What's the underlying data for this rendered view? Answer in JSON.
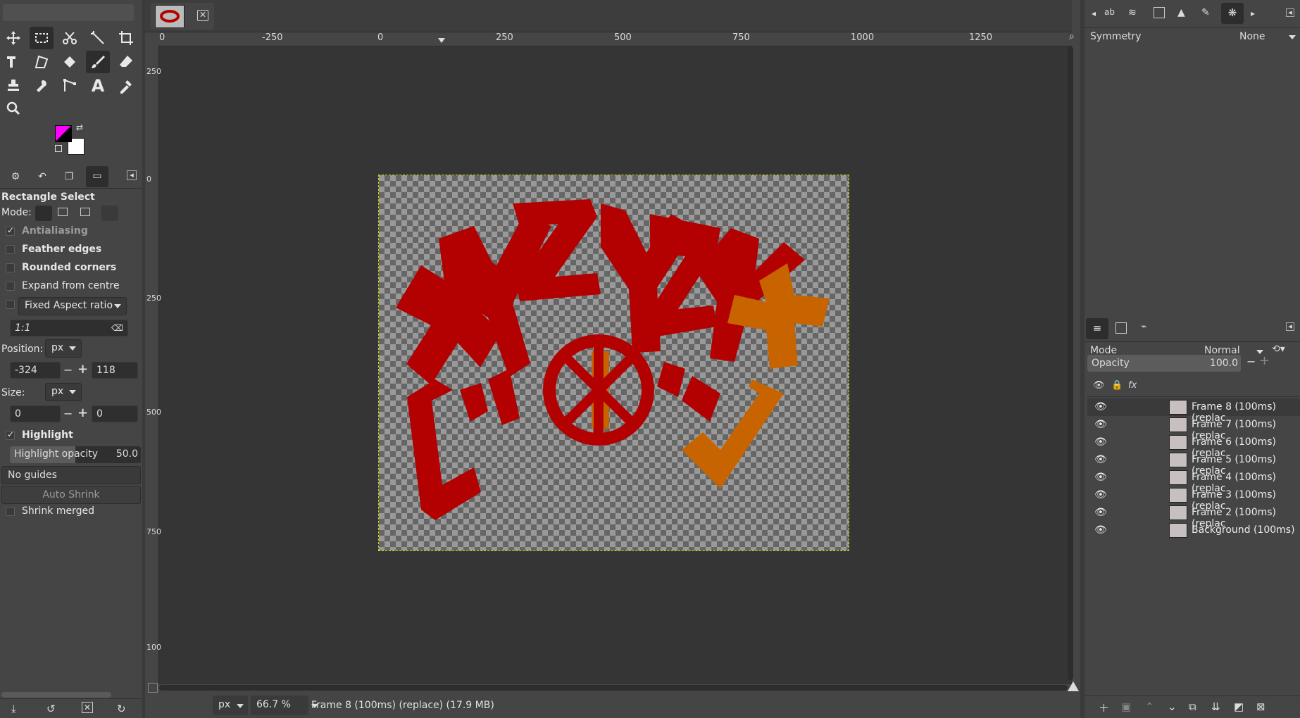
{
  "tab": {
    "close_icon": "close-icon"
  },
  "toolbox": {
    "tools": [
      "move-tool-icon",
      "rectangle-select-icon",
      "scissors-select-icon",
      "fuzzy-select-icon",
      "crop-icon",
      "unified-transform-icon",
      "warp-transform-icon",
      "bucket-fill-icon",
      "paintbrush-icon",
      "eraser-icon",
      "clone-icon",
      "smudge-icon",
      "paths-icon",
      "text-icon",
      "color-picker-icon",
      "zoom-icon"
    ]
  },
  "tool_options": {
    "title": "Rectangle Select",
    "mode_label": "Mode:",
    "antialiasing": "Antialiasing",
    "feather": "Feather edges",
    "rounded": "Rounded corners",
    "expand": "Expand from centre",
    "fixed": "Fixed Aspect ratio",
    "aspect_value": "1:1",
    "position_label": "Position:",
    "position_unit": "px",
    "pos_x": "-324",
    "pos_y": "118",
    "size_label": "Size:",
    "size_unit": "px",
    "size_w": "0",
    "size_h": "0",
    "highlight": "Highlight",
    "highlight_opacity_label": "Highlight opacity",
    "highlight_opacity_value": "50.0",
    "guides": "No guides",
    "auto_shrink": "Auto Shrink",
    "shrink_merged": "Shrink merged"
  },
  "ruler": {
    "top_ticks": [
      "-250",
      "0",
      "250",
      "500",
      "750",
      "1000",
      "1250"
    ],
    "top_zero": "0",
    "left_ticks": [
      "250",
      "0",
      "250",
      "500",
      "750",
      "100"
    ]
  },
  "status": {
    "unit": "px",
    "zoom": "66.7 %",
    "message": "Frame 8 (100ms) (replace) (17.9 MB)"
  },
  "symmetry": {
    "label": "Symmetry",
    "value": "None"
  },
  "layers": {
    "mode_label": "Mode",
    "mode_value": "Normal",
    "opacity_label": "Opacity",
    "opacity_value": "100.0",
    "items": [
      "Frame 8 (100ms) (replac",
      "Frame 7 (100ms) (replac",
      "Frame 6 (100ms) (replac",
      "Frame 5 (100ms) (replac",
      "Frame 4 (100ms) (replac",
      "Frame 3 (100ms) (replac",
      "Frame 2 (100ms) (replac",
      "Background (100ms)"
    ]
  },
  "colors": {
    "fg": "#ff00ff",
    "bg": "#ffffff",
    "art_red": "#b30000",
    "art_orange": "#c86400"
  }
}
